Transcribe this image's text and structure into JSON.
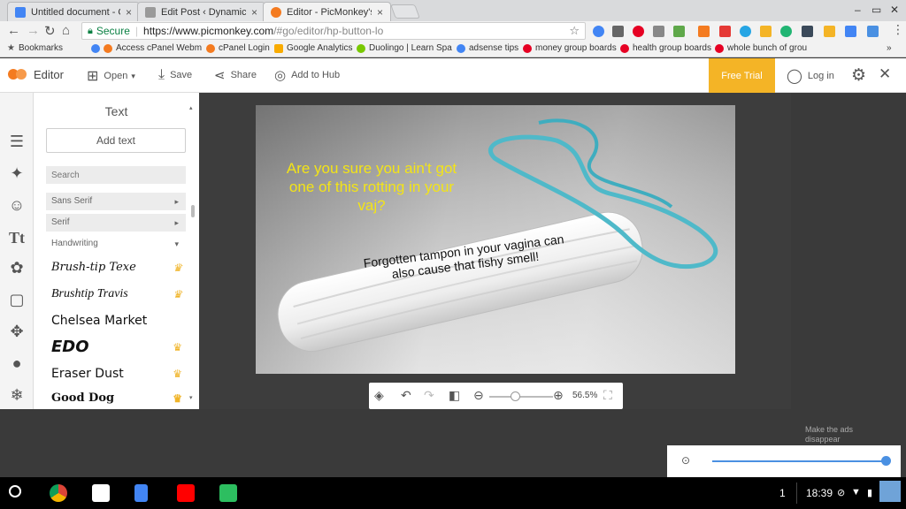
{
  "browser": {
    "tabs": [
      {
        "title": "Untitled document - Goo",
        "favicon_color": "#4285f4"
      },
      {
        "title": "Edit Post ‹ DynamicWith",
        "favicon_color": "#9a9a9a"
      },
      {
        "title": "Editor - PicMonkey's Pho",
        "favicon_color": "#f47b20"
      }
    ],
    "secure_label": "Secure",
    "url_host": "https://www.picmonkey.com",
    "url_path": "/#go/editor/hp-button-lo",
    "bookmarks": [
      {
        "label": "Bookmarks",
        "color": "#555"
      },
      {
        "label": "Access cPanel Webm",
        "color": "#f47b20"
      },
      {
        "label": "cPanel Login",
        "color": "#f47b20"
      },
      {
        "label": "Google Analytics",
        "color": "#f9ab00"
      },
      {
        "label": "Duolingo | Learn Spa",
        "color": "#78c800"
      },
      {
        "label": "adsense tips",
        "color": "#4285f4"
      },
      {
        "label": "money group boards",
        "color": "#e60023"
      },
      {
        "label": "health group boards",
        "color": "#e60023"
      },
      {
        "label": "whole bunch of grou",
        "color": "#e60023"
      }
    ],
    "more_bookmarks": "»"
  },
  "app": {
    "editor_label": "Editor",
    "open_label": "Open",
    "save_label": "Save",
    "share_label": "Share",
    "hub_label": "Add to Hub",
    "free_trial_label": "Free Trial",
    "login_label": "Log in",
    "brand_color": "#f47b20",
    "trial_color": "#f4b426"
  },
  "panel": {
    "title": "Text",
    "add_text_label": "Add text",
    "search_placeholder": "Search",
    "categories": [
      "Sans Serif",
      "Serif",
      "Handwriting"
    ],
    "fonts": [
      {
        "name": "Brush-tip Texe",
        "premium": true
      },
      {
        "name": "Brushtip Travis",
        "premium": true
      },
      {
        "name": "Chelsea Market",
        "premium": false
      },
      {
        "name": "EDO",
        "premium": true
      },
      {
        "name": "Eraser Dust",
        "premium": true
      },
      {
        "name": "Good Dog",
        "premium": true
      }
    ]
  },
  "canvas": {
    "caption_yellow": "Are you sure you ain't got one of this rotting in your vaj?",
    "caption_black": "Forgotten tampon in your vagina can also cause that fishy smell!",
    "zoom_percent": "56.5%",
    "zoom_level": 0.4
  },
  "ads": {
    "note": "Make the ads disappear",
    "slider_level": 1.0
  },
  "shelf": {
    "notification_count": "1",
    "time": "18:39"
  }
}
